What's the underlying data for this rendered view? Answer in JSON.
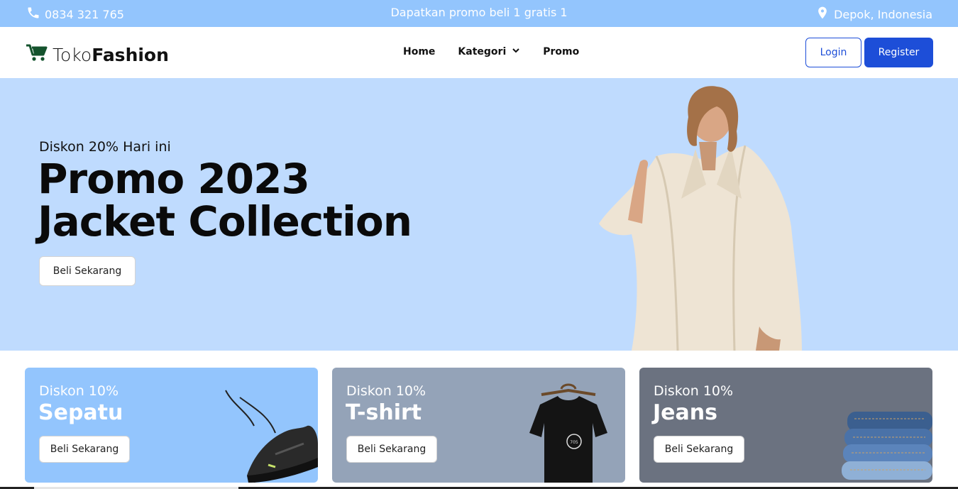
{
  "topbar": {
    "phone": "0834 321 765",
    "promo": "Dapatkan promo beli 1 gratis 1",
    "location": "Depok, Indonesia"
  },
  "navbar": {
    "logo_light": "Toko",
    "logo_bold": "Fashion",
    "links": [
      "Home",
      "Kategori",
      "Promo"
    ],
    "login": "Login",
    "register": "Register"
  },
  "hero": {
    "subtitle": "Diskon 20% Hari ini",
    "title_line1": "Promo 2023",
    "title_line2": "Jacket Collection",
    "button": "Beli Sekarang"
  },
  "cards": [
    {
      "discount": "Diskon 10%",
      "name": "Sepatu",
      "button": "Beli Sekarang",
      "color": "#93c5fd"
    },
    {
      "discount": "Diskon 10%",
      "name": "T-shirt",
      "button": "Beli Sekarang",
      "color": "#94a3b8"
    },
    {
      "discount": "Diskon 10%",
      "name": "Jeans",
      "button": "Beli Sekarang",
      "color": "#6b7280"
    }
  ],
  "colors": {
    "topbar": "#93c5fd",
    "primary": "#1d4ed8",
    "hero_bg": "#bfdbfe"
  }
}
